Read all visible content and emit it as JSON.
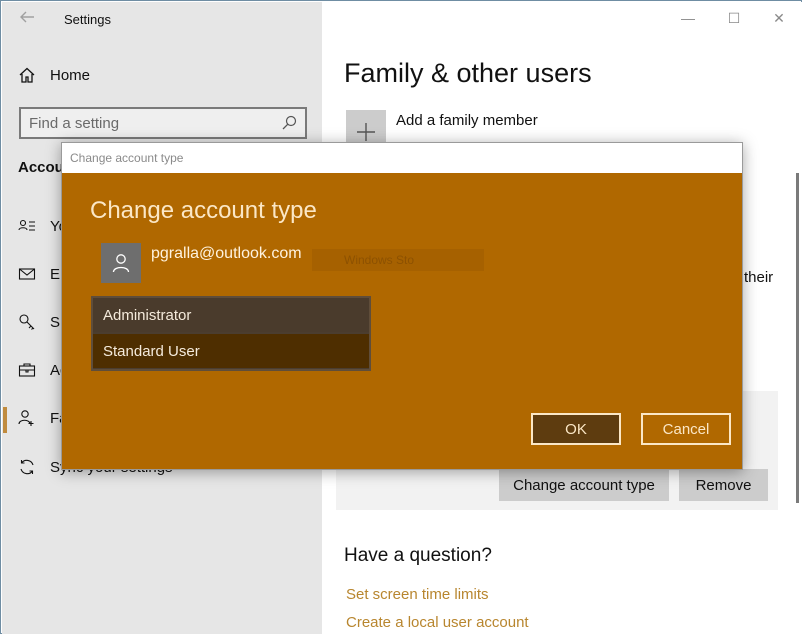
{
  "window": {
    "title": "Settings",
    "controls": {
      "minimize": "—",
      "maximize": "☐",
      "close": "✕"
    }
  },
  "sidebar": {
    "back_icon": "back-arrow-icon",
    "home_label": "Home",
    "search": {
      "placeholder": "Find a setting",
      "value": ""
    },
    "section_title": "Accounts",
    "items": [
      {
        "label": "Your info",
        "icon": "your-info-icon"
      },
      {
        "label": "Email & app accounts",
        "icon": "email-icon"
      },
      {
        "label": "Sign-in options",
        "icon": "key-icon"
      },
      {
        "label": "Access work or school",
        "icon": "briefcase-icon"
      },
      {
        "label": "Family & other users",
        "icon": "add-person-icon",
        "active": true
      },
      {
        "label": "Sync your settings",
        "icon": "sync-icon"
      }
    ]
  },
  "main": {
    "page_title": "Family & other users",
    "add_family_label": "Add a family member",
    "partial_text": "their",
    "buttons": {
      "change_account_type": "Change account type",
      "remove": "Remove"
    },
    "help": {
      "heading": "Have a question?",
      "links": [
        "Set screen time limits",
        "Create a local user account"
      ]
    }
  },
  "dialog": {
    "window_title": "Change account type",
    "heading": "Change account type",
    "account_email": "pgralla@outlook.com",
    "ghost_text": "Windows Sto",
    "options": [
      "Administrator",
      "Standard User"
    ],
    "selected_option": "Standard User",
    "ok_label": "OK",
    "cancel_label": "Cancel",
    "accent_color": "#b06800"
  }
}
